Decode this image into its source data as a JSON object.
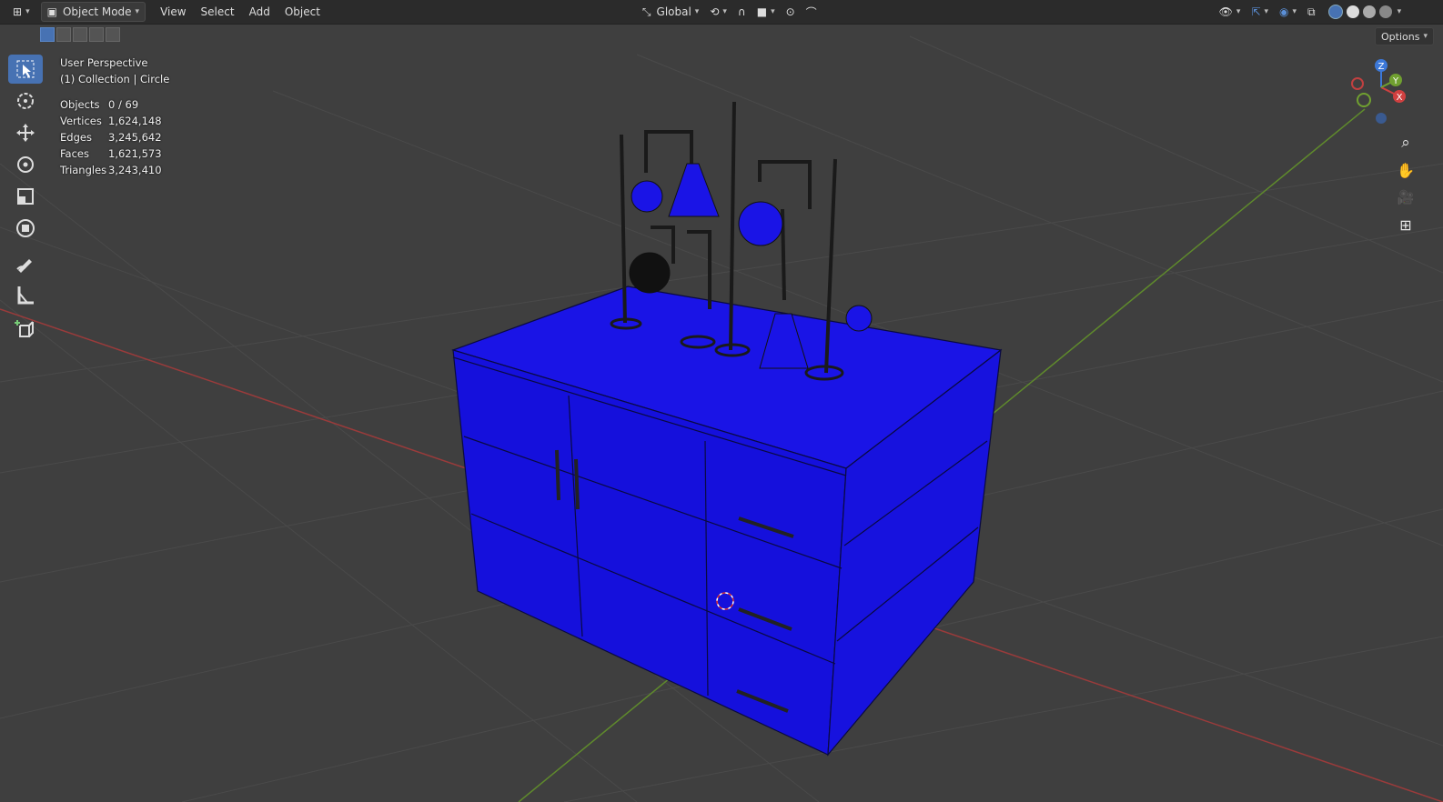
{
  "header": {
    "mode_label": "Object Mode",
    "menus": [
      "View",
      "Select",
      "Add",
      "Object"
    ],
    "orientation_label": "Global",
    "options_label": "Options"
  },
  "overlay": {
    "perspective": "User Perspective",
    "collection": "(1) Collection | Circle"
  },
  "stats": [
    {
      "label": "Objects",
      "value": "0 / 69"
    },
    {
      "label": "Vertices",
      "value": "1,624,148"
    },
    {
      "label": "Edges",
      "value": "3,245,642"
    },
    {
      "label": "Faces",
      "value": "1,621,573"
    },
    {
      "label": "Triangles",
      "value": "3,243,410"
    }
  ],
  "gizmo": {
    "x": "X",
    "y": "Y",
    "z": "Z"
  },
  "tools": [
    "select-box-icon",
    "cursor-icon",
    "move-icon",
    "rotate-icon",
    "scale-icon",
    "transform-icon",
    "annotate-icon",
    "measure-icon",
    "add-cube-icon"
  ],
  "colors": {
    "mesh": "#1a14e6",
    "x_axis": "#c44a4a",
    "y_axis": "#6a9a2a",
    "accent": "#4772b3"
  }
}
